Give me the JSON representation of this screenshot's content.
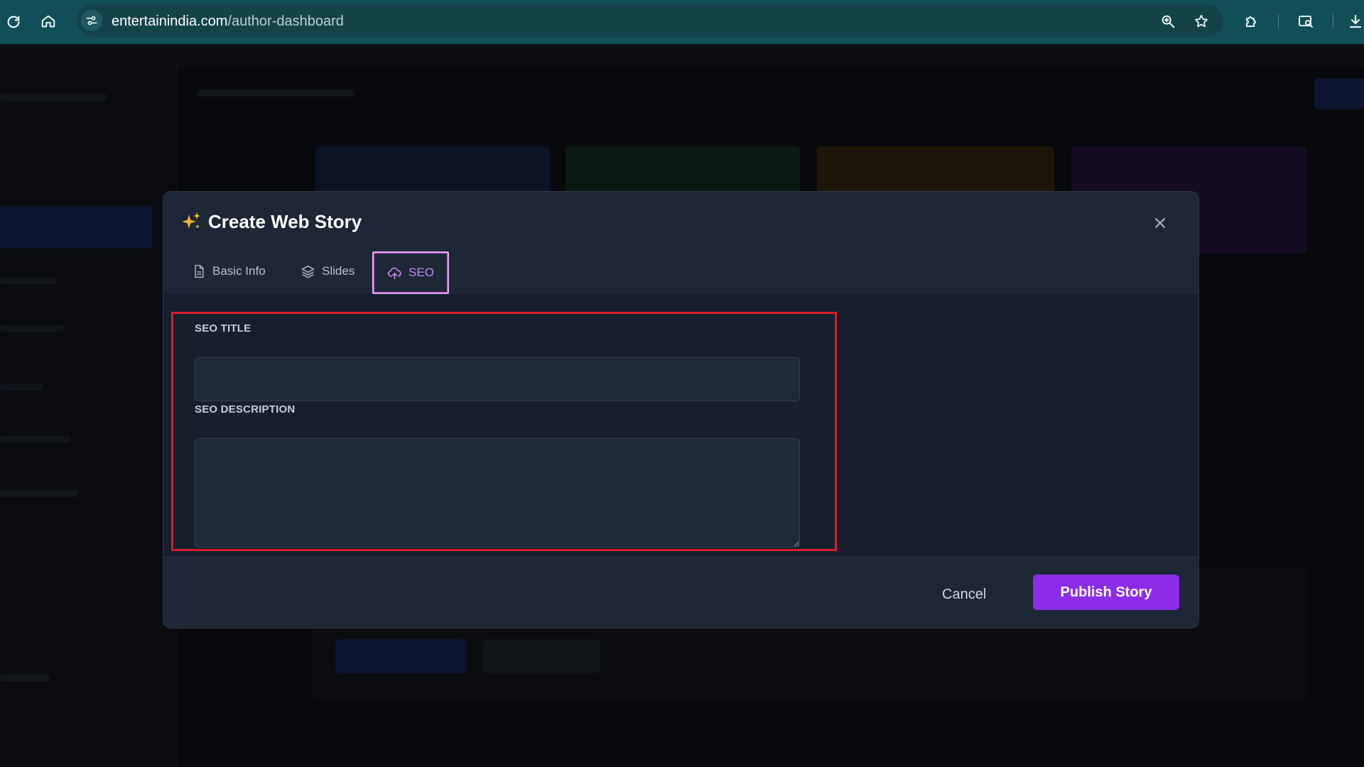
{
  "browser": {
    "url_host": "entertainindia.com",
    "url_path": "/author-dashboard"
  },
  "modal": {
    "title": "Create Web Story",
    "tabs": [
      {
        "label": "Basic Info",
        "icon": "document-icon",
        "active": false
      },
      {
        "label": "Slides",
        "icon": "layers-icon",
        "active": false
      },
      {
        "label": "SEO",
        "icon": "upload-cloud-icon",
        "active": true
      }
    ],
    "fields": {
      "seo_title_label": "SEO TITLE",
      "seo_title_value": "",
      "seo_description_label": "SEO DESCRIPTION",
      "seo_description_value": ""
    },
    "footer": {
      "cancel_label": "Cancel",
      "publish_label": "Publish Story"
    }
  },
  "colors": {
    "accent": "#8b2ce7",
    "active_tab_text": "#c18bf5",
    "highlight": "#d81f2a",
    "sparkle": "#f5b82e"
  }
}
